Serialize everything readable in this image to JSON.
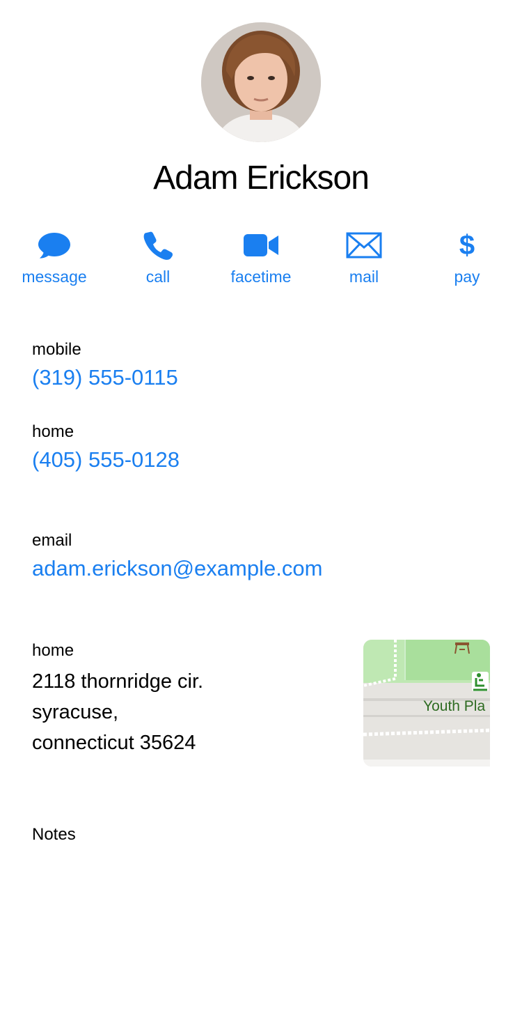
{
  "contact": {
    "name": "Adam Erickson"
  },
  "actions": [
    {
      "label": "message",
      "icon": "message-bubble-icon"
    },
    {
      "label": "call",
      "icon": "phone-icon"
    },
    {
      "label": "facetime",
      "icon": "video-camera-icon"
    },
    {
      "label": "mail",
      "icon": "envelope-icon"
    },
    {
      "label": "pay",
      "icon": "dollar-icon"
    }
  ],
  "phones": [
    {
      "label": "mobile",
      "value": "(319) 555-0115"
    },
    {
      "label": "home",
      "value": "(405) 555-0128"
    }
  ],
  "email": {
    "label": "email",
    "value": "adam.erickson@example.com"
  },
  "address": {
    "label": "home",
    "lines": [
      "2118 thornridge cir.",
      "syracuse,",
      "connecticut 35624"
    ],
    "map_label": "Youth Pla"
  },
  "notes": {
    "label": "Notes"
  },
  "colors": {
    "accent": "#1a7ff0",
    "text": "#000000",
    "background": "#ffffff"
  }
}
